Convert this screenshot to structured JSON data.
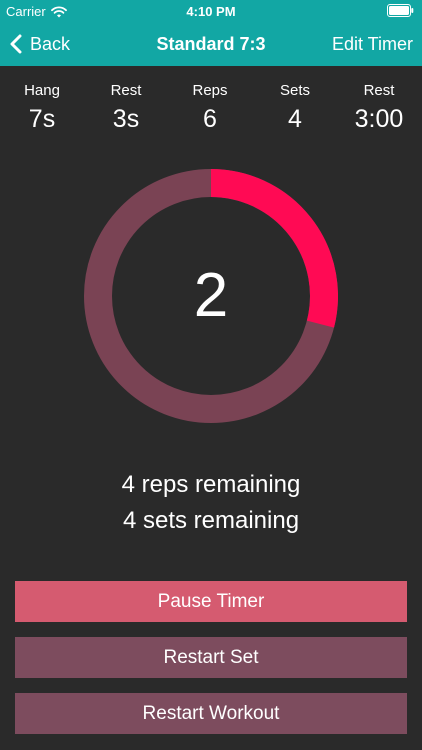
{
  "status_bar": {
    "carrier": "Carrier",
    "time": "4:10 PM"
  },
  "nav": {
    "back_label": "Back",
    "title": "Standard 7:3",
    "edit_label": "Edit Timer"
  },
  "stats": [
    {
      "label": "Hang",
      "value": "7s"
    },
    {
      "label": "Rest",
      "value": "3s"
    },
    {
      "label": "Reps",
      "value": "6"
    },
    {
      "label": "Sets",
      "value": "4"
    },
    {
      "label": "Rest",
      "value": "3:00"
    }
  ],
  "timer": {
    "current": "2",
    "progress_fraction": 0.29
  },
  "remaining": {
    "reps": "4 reps remaining",
    "sets": "4 sets remaining"
  },
  "buttons": {
    "pause": "Pause Timer",
    "restart_set": "Restart Set",
    "restart_workout": "Restart Workout"
  },
  "colors": {
    "header": "#12a7a4",
    "background": "#2a2a2a",
    "ring_track": "#7a4354",
    "ring_progress": "#ff0a54",
    "pause_button": "#d55b70",
    "secondary_button": "#7d4c5e"
  }
}
